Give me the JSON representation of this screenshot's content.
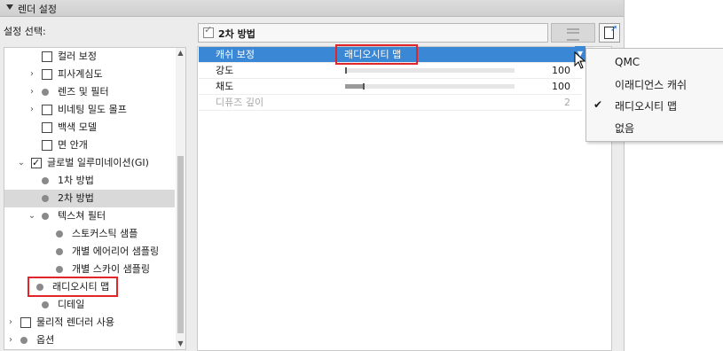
{
  "header": {
    "title": "렌더 설정"
  },
  "left": {
    "select_label": "설정 선택:",
    "tree": [
      {
        "label": "컬러 보정",
        "kind": "checkbox",
        "checked": false,
        "arrow": ""
      },
      {
        "label": "피사계심도",
        "kind": "checkbox",
        "checked": false,
        "arrow": "›"
      },
      {
        "label": "렌즈 및 필터",
        "kind": "dot",
        "arrow": "›"
      },
      {
        "label": "비네팅 밀도 몰프",
        "kind": "checkbox",
        "checked": false,
        "arrow": "›"
      },
      {
        "label": "백색 모델",
        "kind": "checkbox",
        "checked": false,
        "arrow": ""
      },
      {
        "label": "면 안개",
        "kind": "checkbox",
        "checked": false,
        "arrow": ""
      },
      {
        "label": "글로벌 일루미네이션(GI)",
        "kind": "checkbox",
        "checked": true,
        "arrow": "⌄"
      },
      {
        "label": "1차 방법",
        "kind": "dot",
        "arrow": ""
      },
      {
        "label": "2차 방법",
        "kind": "dot",
        "arrow": "",
        "selected": true
      },
      {
        "label": "텍스쳐 필터",
        "kind": "dot",
        "arrow": "⌄"
      },
      {
        "label": "스토커스틱 샘플",
        "kind": "dot",
        "arrow": ""
      },
      {
        "label": "개별 에어리어 샘플링",
        "kind": "dot",
        "arrow": ""
      },
      {
        "label": "개별 스카이 샘플링",
        "kind": "dot",
        "arrow": ""
      },
      {
        "label": "래디오시티 맵",
        "kind": "dot",
        "arrow": "",
        "highlight": true
      },
      {
        "label": "디테일",
        "kind": "dot",
        "arrow": ""
      },
      {
        "label": "물리적 렌더러 사용",
        "kind": "checkbox",
        "checked": false,
        "arrow": "›"
      },
      {
        "label": "옵션",
        "kind": "dot",
        "arrow": "›"
      }
    ]
  },
  "right": {
    "method_title": "2차 방법",
    "properties": [
      {
        "name": "캐쉬 보정",
        "value": "래디오시티 맵",
        "selected": true
      },
      {
        "name": "강도",
        "number": "100",
        "slider": 0.0
      },
      {
        "name": "채도",
        "number": "100",
        "slider": 0.11
      },
      {
        "name": "디퓨즈 깊이",
        "number": "2",
        "disabled": true
      }
    ]
  },
  "dropdown": {
    "items": [
      "QMC",
      "이래디언스 캐쉬",
      "래디오시티 맵",
      "없음"
    ],
    "checked_index": 2
  },
  "colors": {
    "selection_blue": "#3a87d6",
    "highlight_red": "#e0262a"
  }
}
